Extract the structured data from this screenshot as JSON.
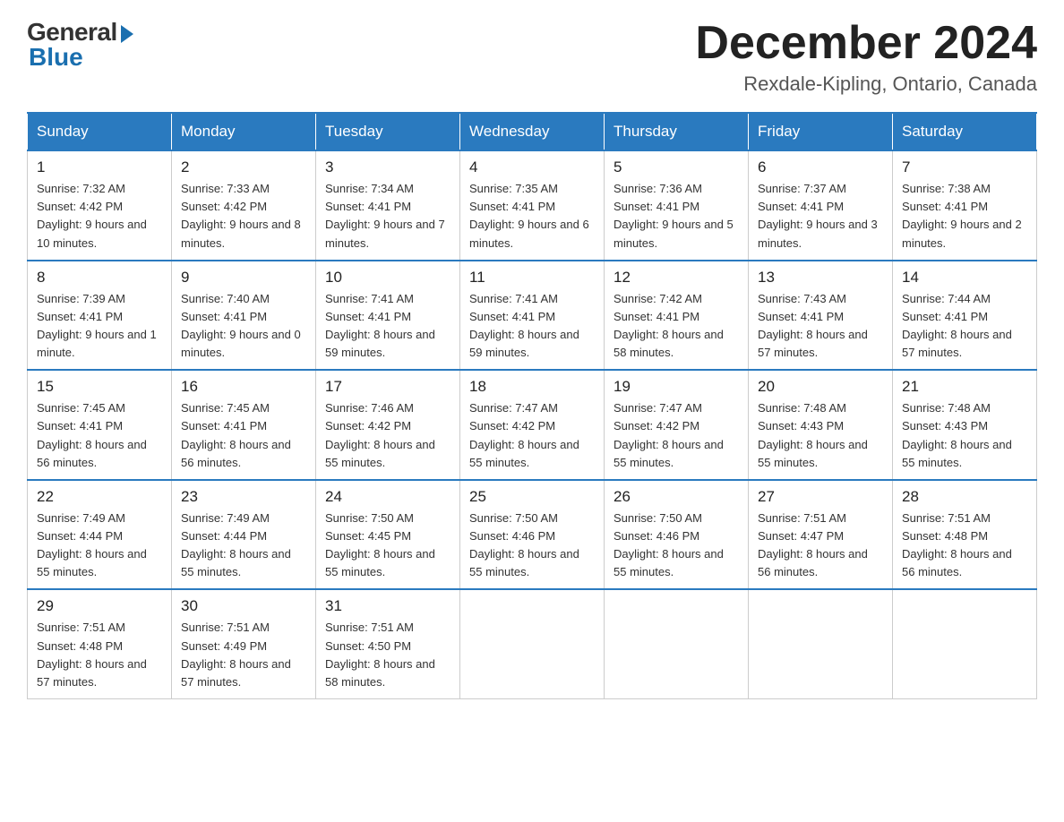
{
  "logo": {
    "general": "General",
    "blue": "Blue"
  },
  "title": "December 2024",
  "location": "Rexdale-Kipling, Ontario, Canada",
  "days_of_week": [
    "Sunday",
    "Monday",
    "Tuesday",
    "Wednesday",
    "Thursday",
    "Friday",
    "Saturday"
  ],
  "weeks": [
    [
      {
        "day": "1",
        "sunrise": "7:32 AM",
        "sunset": "4:42 PM",
        "daylight": "9 hours and 10 minutes."
      },
      {
        "day": "2",
        "sunrise": "7:33 AM",
        "sunset": "4:42 PM",
        "daylight": "9 hours and 8 minutes."
      },
      {
        "day": "3",
        "sunrise": "7:34 AM",
        "sunset": "4:41 PM",
        "daylight": "9 hours and 7 minutes."
      },
      {
        "day": "4",
        "sunrise": "7:35 AM",
        "sunset": "4:41 PM",
        "daylight": "9 hours and 6 minutes."
      },
      {
        "day": "5",
        "sunrise": "7:36 AM",
        "sunset": "4:41 PM",
        "daylight": "9 hours and 5 minutes."
      },
      {
        "day": "6",
        "sunrise": "7:37 AM",
        "sunset": "4:41 PM",
        "daylight": "9 hours and 3 minutes."
      },
      {
        "day": "7",
        "sunrise": "7:38 AM",
        "sunset": "4:41 PM",
        "daylight": "9 hours and 2 minutes."
      }
    ],
    [
      {
        "day": "8",
        "sunrise": "7:39 AM",
        "sunset": "4:41 PM",
        "daylight": "9 hours and 1 minute."
      },
      {
        "day": "9",
        "sunrise": "7:40 AM",
        "sunset": "4:41 PM",
        "daylight": "9 hours and 0 minutes."
      },
      {
        "day": "10",
        "sunrise": "7:41 AM",
        "sunset": "4:41 PM",
        "daylight": "8 hours and 59 minutes."
      },
      {
        "day": "11",
        "sunrise": "7:41 AM",
        "sunset": "4:41 PM",
        "daylight": "8 hours and 59 minutes."
      },
      {
        "day": "12",
        "sunrise": "7:42 AM",
        "sunset": "4:41 PM",
        "daylight": "8 hours and 58 minutes."
      },
      {
        "day": "13",
        "sunrise": "7:43 AM",
        "sunset": "4:41 PM",
        "daylight": "8 hours and 57 minutes."
      },
      {
        "day": "14",
        "sunrise": "7:44 AM",
        "sunset": "4:41 PM",
        "daylight": "8 hours and 57 minutes."
      }
    ],
    [
      {
        "day": "15",
        "sunrise": "7:45 AM",
        "sunset": "4:41 PM",
        "daylight": "8 hours and 56 minutes."
      },
      {
        "day": "16",
        "sunrise": "7:45 AM",
        "sunset": "4:41 PM",
        "daylight": "8 hours and 56 minutes."
      },
      {
        "day": "17",
        "sunrise": "7:46 AM",
        "sunset": "4:42 PM",
        "daylight": "8 hours and 55 minutes."
      },
      {
        "day": "18",
        "sunrise": "7:47 AM",
        "sunset": "4:42 PM",
        "daylight": "8 hours and 55 minutes."
      },
      {
        "day": "19",
        "sunrise": "7:47 AM",
        "sunset": "4:42 PM",
        "daylight": "8 hours and 55 minutes."
      },
      {
        "day": "20",
        "sunrise": "7:48 AM",
        "sunset": "4:43 PM",
        "daylight": "8 hours and 55 minutes."
      },
      {
        "day": "21",
        "sunrise": "7:48 AM",
        "sunset": "4:43 PM",
        "daylight": "8 hours and 55 minutes."
      }
    ],
    [
      {
        "day": "22",
        "sunrise": "7:49 AM",
        "sunset": "4:44 PM",
        "daylight": "8 hours and 55 minutes."
      },
      {
        "day": "23",
        "sunrise": "7:49 AM",
        "sunset": "4:44 PM",
        "daylight": "8 hours and 55 minutes."
      },
      {
        "day": "24",
        "sunrise": "7:50 AM",
        "sunset": "4:45 PM",
        "daylight": "8 hours and 55 minutes."
      },
      {
        "day": "25",
        "sunrise": "7:50 AM",
        "sunset": "4:46 PM",
        "daylight": "8 hours and 55 minutes."
      },
      {
        "day": "26",
        "sunrise": "7:50 AM",
        "sunset": "4:46 PM",
        "daylight": "8 hours and 55 minutes."
      },
      {
        "day": "27",
        "sunrise": "7:51 AM",
        "sunset": "4:47 PM",
        "daylight": "8 hours and 56 minutes."
      },
      {
        "day": "28",
        "sunrise": "7:51 AM",
        "sunset": "4:48 PM",
        "daylight": "8 hours and 56 minutes."
      }
    ],
    [
      {
        "day": "29",
        "sunrise": "7:51 AM",
        "sunset": "4:48 PM",
        "daylight": "8 hours and 57 minutes."
      },
      {
        "day": "30",
        "sunrise": "7:51 AM",
        "sunset": "4:49 PM",
        "daylight": "8 hours and 57 minutes."
      },
      {
        "day": "31",
        "sunrise": "7:51 AM",
        "sunset": "4:50 PM",
        "daylight": "8 hours and 58 minutes."
      },
      null,
      null,
      null,
      null
    ]
  ],
  "labels": {
    "sunrise": "Sunrise:",
    "sunset": "Sunset:",
    "daylight": "Daylight:"
  }
}
